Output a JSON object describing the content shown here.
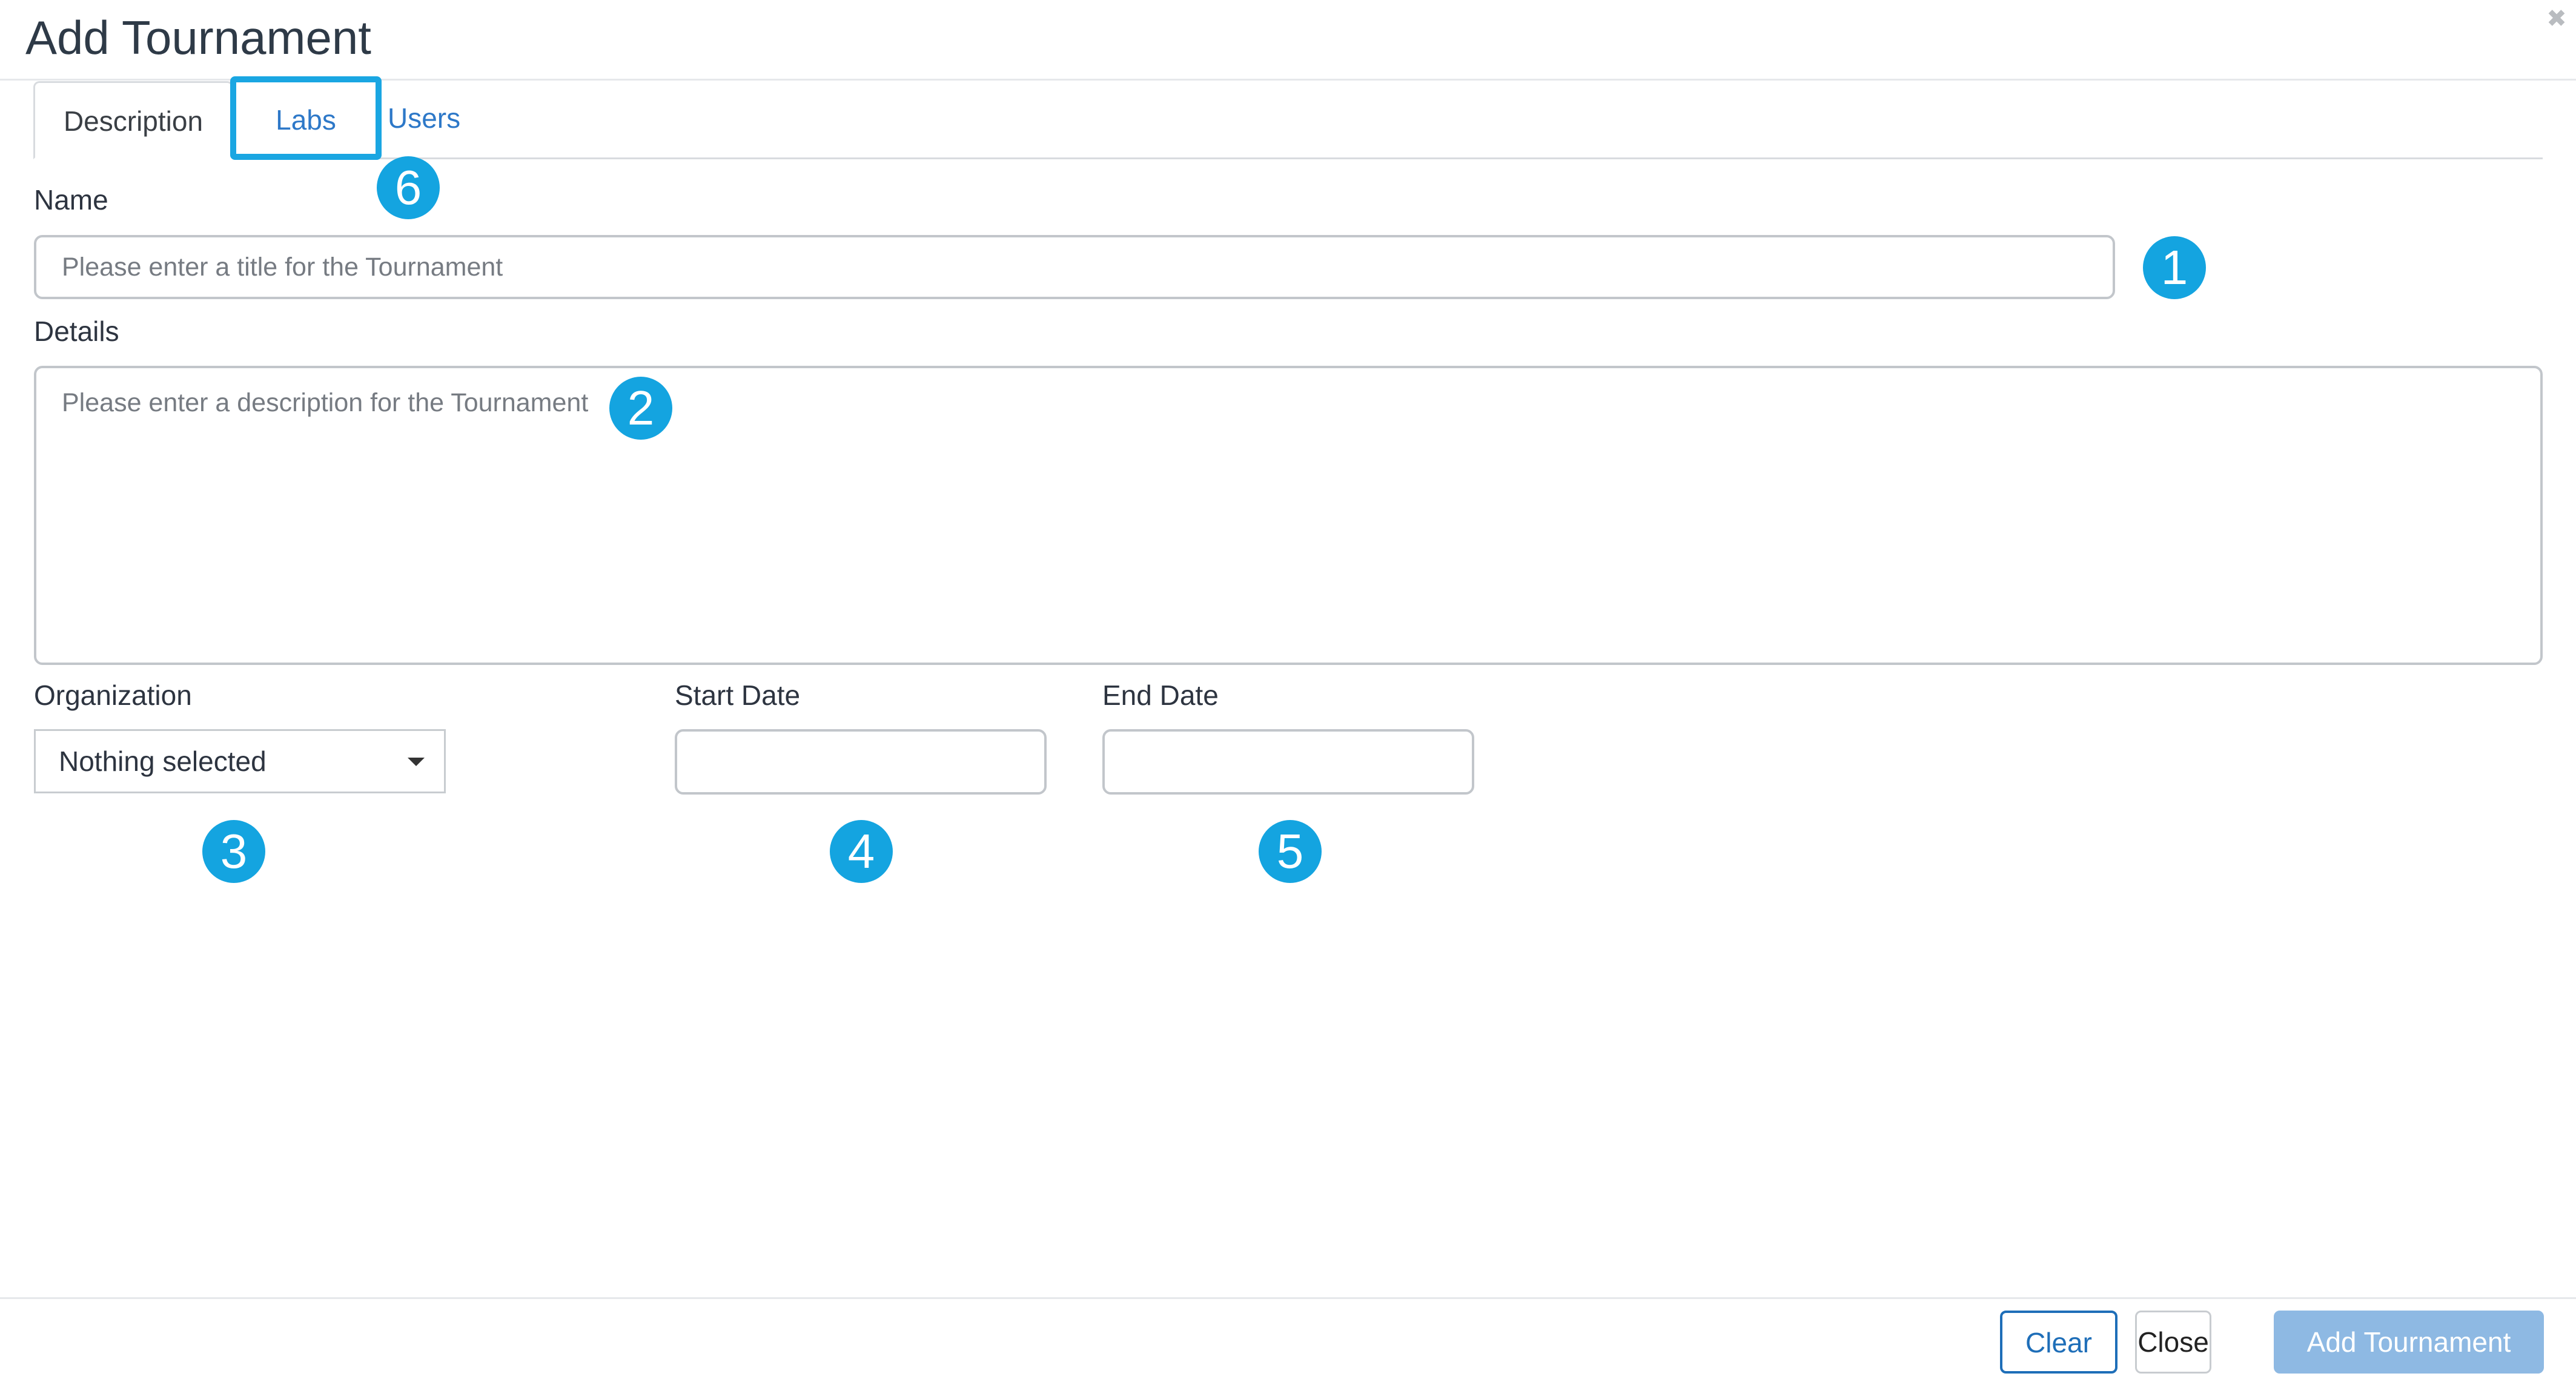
{
  "modal": {
    "title": "Add Tournament",
    "close_icon": "close-icon"
  },
  "tabs": [
    {
      "label": "Description",
      "active": true
    },
    {
      "label": "Labs",
      "highlighted": true
    },
    {
      "label": "Users"
    }
  ],
  "form": {
    "name_label": "Name",
    "name_placeholder": "Please enter a title for the Tournament",
    "name_value": "",
    "details_label": "Details",
    "details_placeholder": "Please enter a description for the Tournament",
    "details_value": "",
    "organization_label": "Organization",
    "organization_value": "Nothing selected",
    "start_date_label": "Start Date",
    "start_date_value": "",
    "end_date_label": "End Date",
    "end_date_value": ""
  },
  "callouts": [
    "1",
    "2",
    "3",
    "4",
    "5",
    "6"
  ],
  "footer": {
    "clear_label": "Clear",
    "close_label": "Close",
    "add_label": "Add Tournament"
  },
  "colors": {
    "accent": "#14a4e0",
    "link": "#2d78c8",
    "primary_disabled": "#8eb9e3"
  }
}
